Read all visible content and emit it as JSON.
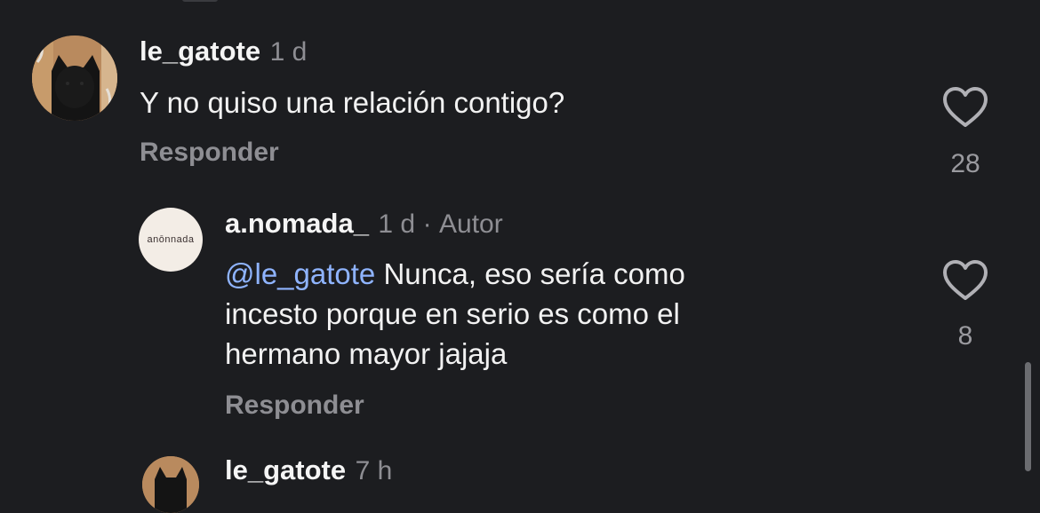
{
  "comments": [
    {
      "username": "le_gatote",
      "time": "1 d",
      "text": "Y no quiso una relación contigo?",
      "reply_label": "Responder",
      "like_count": "28",
      "avatar_icon": "cat-avatar-icon"
    },
    {
      "username": "a.nomada_",
      "time": "1 d",
      "separator": "·",
      "author_label": "Autor",
      "mention": "@le_gatote",
      "text_line1": " Nunca, eso sería como",
      "text_line2": "incesto porque en serio es como el",
      "text_line3": "hermano mayor jajaja",
      "reply_label": "Responder",
      "like_count": "8",
      "avatar_logo": "anōnnada"
    },
    {
      "username": "le_gatote",
      "time": "7 h"
    }
  ],
  "colors": {
    "background": "#1c1d20",
    "mention": "#8fb4ff",
    "muted": "#8e8e93"
  }
}
